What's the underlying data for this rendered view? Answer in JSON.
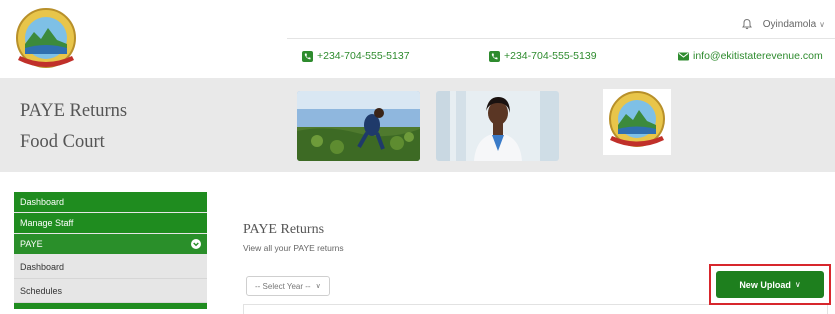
{
  "header": {
    "user_name": "Oyindamola",
    "contacts": [
      {
        "icon": "phone-icon",
        "text": "+234-704-555-5137"
      },
      {
        "icon": "phone-icon",
        "text": "+234-704-555-5139"
      },
      {
        "icon": "mail-icon",
        "text": "info@ekitistaterevenue.com"
      }
    ],
    "logo_text": "EKITI STATE OF NIGERIA"
  },
  "banner": {
    "title_line1": "PAYE Returns",
    "title_line2": "Food Court"
  },
  "sidebar": {
    "items": [
      {
        "label": "Dashboard"
      },
      {
        "label": "Manage Staff"
      },
      {
        "label": "PAYE"
      },
      {
        "label": "Dashboard"
      },
      {
        "label": "Schedules"
      }
    ]
  },
  "main": {
    "title": "PAYE Returns",
    "subtitle": "View all your PAYE returns",
    "year_select": "-- Select Year --",
    "upload_label": "New Upload"
  },
  "colors": {
    "brand_green": "#1f8c1f",
    "highlight_red": "#d7262c"
  }
}
